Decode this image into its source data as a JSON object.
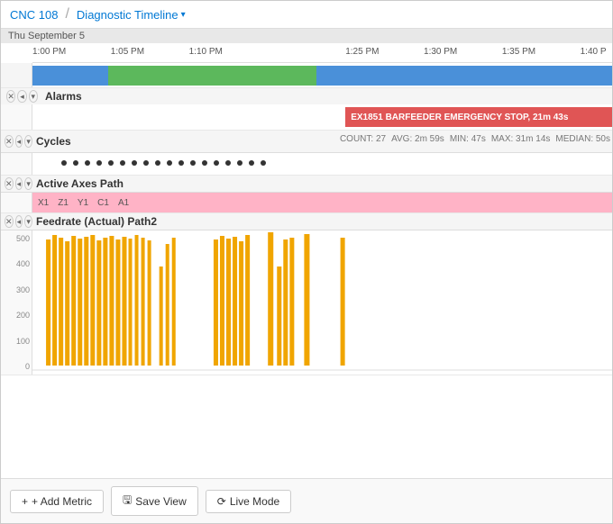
{
  "header": {
    "machine": "CNC 108",
    "separator": "/",
    "title": "Diagnostic Timeline",
    "dropdown_arrow": "▾"
  },
  "date": "Thu September 5",
  "time_labels": [
    {
      "label": "1:00 PM",
      "left_pct": 0
    },
    {
      "label": "1:05 PM",
      "left_pct": 13.5
    },
    {
      "label": "1:10 PM",
      "left_pct": 27
    },
    {
      "label": "1:25 PM",
      "left_pct": 54
    },
    {
      "label": "1:30 PM",
      "left_pct": 67.5
    },
    {
      "label": "1:35 PM",
      "left_pct": 81
    },
    {
      "label": "1:40 P",
      "left_pct": 94.5
    }
  ],
  "rows": {
    "alarms": {
      "title": "Alarms",
      "alarm_text": "EX1851 BARFEEDER EMERGENCY STOP, 21m 43s"
    },
    "cycles": {
      "title": "Cycles",
      "stats": {
        "count": "COUNT: 27",
        "avg": "AVG: 2m 59s",
        "min": "MIN: 47s",
        "max": "MAX: 31m 14s",
        "median": "MEDIAN: 50s"
      },
      "dot_count": 18
    },
    "active_axes": {
      "title": "Active Axes Path",
      "axes": [
        "X1",
        "Z1",
        "Y1",
        "C1",
        "A1"
      ]
    },
    "feedrate": {
      "title": "Feedrate (Actual) Path2",
      "y_labels": [
        "500",
        "400",
        "300",
        "200",
        "100",
        "0"
      ]
    }
  },
  "toolbar": {
    "add_metric": "+ Add Metric",
    "save_view": "Save View",
    "live_mode": "Live Mode"
  }
}
